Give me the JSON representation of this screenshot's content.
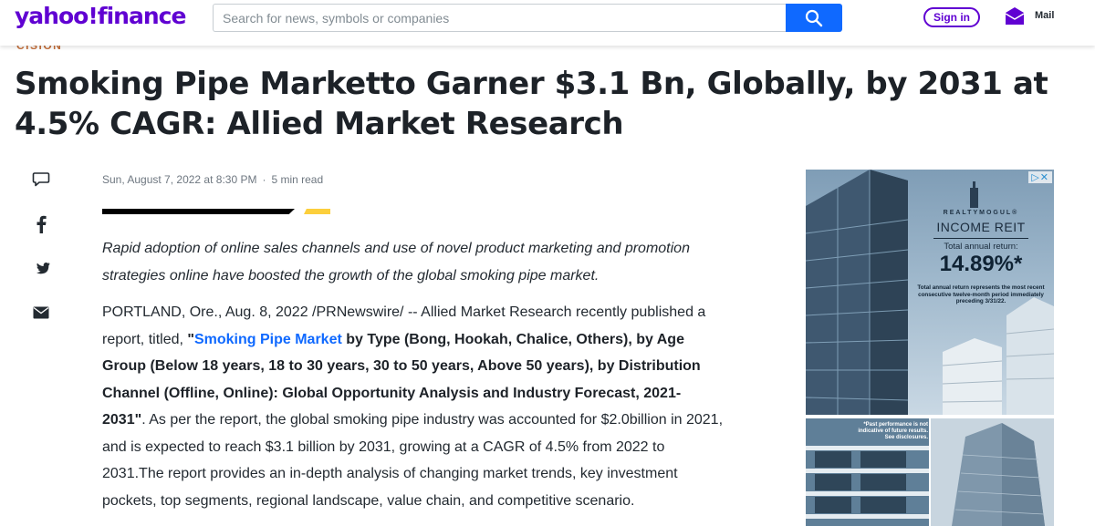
{
  "header": {
    "logo": "yahoo!finance",
    "search_placeholder": "Search for news, symbols or companies",
    "signin_label": "Sign in",
    "mail_label": "Mail",
    "brand_color": "#6001d2",
    "search_button_color": "#0f69ff"
  },
  "article": {
    "source_tag": "CISION",
    "title": "Smoking Pipe Marketto Garner $3.1 Bn, Globally, by 2031 at 4.5% CAGR: Allied Market Research",
    "date": "Sun, August 7, 2022 at 8:30 PM",
    "read_time": "5 min read",
    "summary": "Rapid adoption of online sales channels and use of novel product marketing and promotion strategies online have boosted the growth of the global smoking pipe market.",
    "body": {
      "p1_lead": "PORTLAND, Ore., Aug. 8, 2022 /PRNewswire/ -- Allied Market Research recently published a report, titled, ",
      "p1_quote_open": "\"",
      "p1_link": "Smoking Pipe Market",
      "p1_bold": " by Type (Bong, Hookah, Chalice, Others), by Age Group (Below 18 years, 18 to 30 years, 30 to 50 years, Above 50 years), by Distribution Channel (Offline, Online): Global Opportunity Analysis and Industry Forecast, 2021-2031\"",
      "p1_tail": ". As per the report, the global smoking pipe industry was accounted for $2.0billion in 2021, and is expected to reach $3.1 billion by 2031, growing at a CAGR of 4.5% from 2022 to 2031.The report provides an in-depth analysis of changing market trends, key investment pockets, top segments, regional landscape, value chain, and competitive scenario."
    }
  },
  "share": {
    "icons": [
      "comment-icon",
      "facebook-icon",
      "twitter-icon",
      "email-icon"
    ]
  },
  "ad": {
    "adchoices": "▷✕",
    "brand": "REALTYMOGUL®",
    "product": "INCOME REIT",
    "return_label": "Total annual return:",
    "return_value": "14.89%*",
    "disclaimer": "Total annual return represents the most recent consecutive twelve-month period immediately preceding 3/31/22.",
    "past_performance": "*Past performance is not indicative of future results. See disclosures."
  }
}
